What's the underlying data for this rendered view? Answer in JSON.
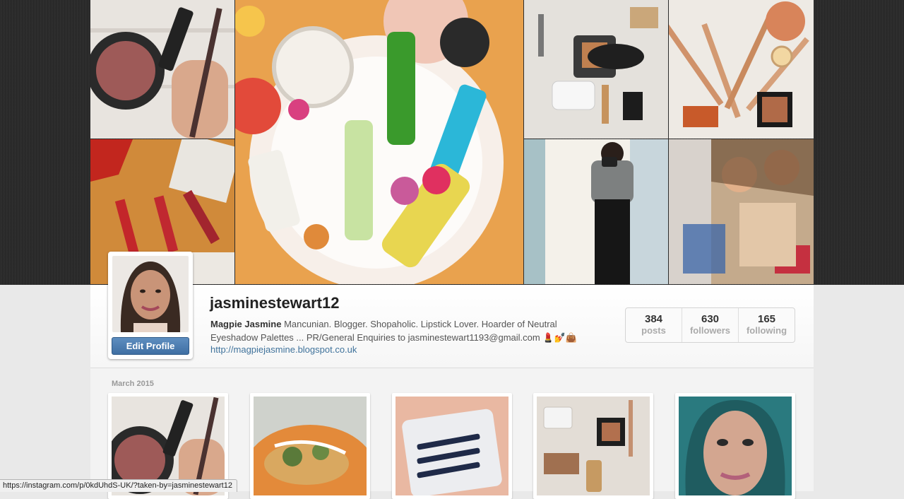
{
  "profile": {
    "username": "jasminestewart12",
    "full_name": "Magpie Jasmine",
    "bio": "Mancunian. Blogger. Shopaholic. Lipstick Lover. Hoarder of Neutral Eyeshadow Palettes ... PR/General Enquiries to jasminestewart1193@gmail.com 💄💅👜",
    "website": "http://magpiejasmine.blogspot.co.uk",
    "edit_button": "Edit Profile"
  },
  "stats": [
    {
      "value": "384",
      "label": "posts"
    },
    {
      "value": "630",
      "label": "followers"
    },
    {
      "value": "165",
      "label": "following"
    }
  ],
  "feed": {
    "month_label": "March 2015"
  },
  "status_bar": {
    "url": "https://instagram.com/p/0kdUhdS-UK/?taken-by=jasminestewart12"
  },
  "colors": {
    "link": "#3f729b",
    "button": "#4d7fb4"
  }
}
